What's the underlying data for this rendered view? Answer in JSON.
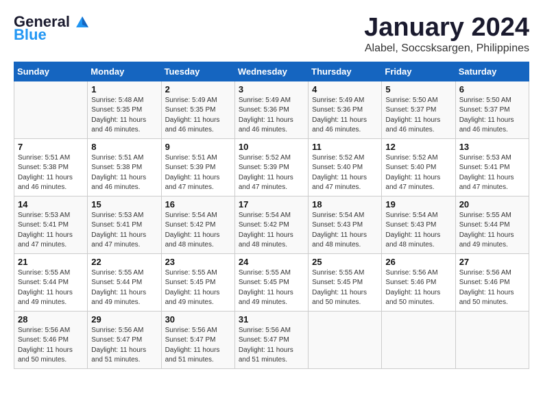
{
  "header": {
    "logo_line1": "General",
    "logo_line2": "Blue",
    "month": "January 2024",
    "location": "Alabel, Soccsksargen, Philippines"
  },
  "days_of_week": [
    "Sunday",
    "Monday",
    "Tuesday",
    "Wednesday",
    "Thursday",
    "Friday",
    "Saturday"
  ],
  "weeks": [
    [
      {
        "day": "",
        "info": ""
      },
      {
        "day": "1",
        "info": "Sunrise: 5:48 AM\nSunset: 5:35 PM\nDaylight: 11 hours\nand 46 minutes."
      },
      {
        "day": "2",
        "info": "Sunrise: 5:49 AM\nSunset: 5:35 PM\nDaylight: 11 hours\nand 46 minutes."
      },
      {
        "day": "3",
        "info": "Sunrise: 5:49 AM\nSunset: 5:36 PM\nDaylight: 11 hours\nand 46 minutes."
      },
      {
        "day": "4",
        "info": "Sunrise: 5:49 AM\nSunset: 5:36 PM\nDaylight: 11 hours\nand 46 minutes."
      },
      {
        "day": "5",
        "info": "Sunrise: 5:50 AM\nSunset: 5:37 PM\nDaylight: 11 hours\nand 46 minutes."
      },
      {
        "day": "6",
        "info": "Sunrise: 5:50 AM\nSunset: 5:37 PM\nDaylight: 11 hours\nand 46 minutes."
      }
    ],
    [
      {
        "day": "7",
        "info": "Sunrise: 5:51 AM\nSunset: 5:38 PM\nDaylight: 11 hours\nand 46 minutes."
      },
      {
        "day": "8",
        "info": "Sunrise: 5:51 AM\nSunset: 5:38 PM\nDaylight: 11 hours\nand 46 minutes."
      },
      {
        "day": "9",
        "info": "Sunrise: 5:51 AM\nSunset: 5:39 PM\nDaylight: 11 hours\nand 47 minutes."
      },
      {
        "day": "10",
        "info": "Sunrise: 5:52 AM\nSunset: 5:39 PM\nDaylight: 11 hours\nand 47 minutes."
      },
      {
        "day": "11",
        "info": "Sunrise: 5:52 AM\nSunset: 5:40 PM\nDaylight: 11 hours\nand 47 minutes."
      },
      {
        "day": "12",
        "info": "Sunrise: 5:52 AM\nSunset: 5:40 PM\nDaylight: 11 hours\nand 47 minutes."
      },
      {
        "day": "13",
        "info": "Sunrise: 5:53 AM\nSunset: 5:41 PM\nDaylight: 11 hours\nand 47 minutes."
      }
    ],
    [
      {
        "day": "14",
        "info": "Sunrise: 5:53 AM\nSunset: 5:41 PM\nDaylight: 11 hours\nand 47 minutes."
      },
      {
        "day": "15",
        "info": "Sunrise: 5:53 AM\nSunset: 5:41 PM\nDaylight: 11 hours\nand 47 minutes."
      },
      {
        "day": "16",
        "info": "Sunrise: 5:54 AM\nSunset: 5:42 PM\nDaylight: 11 hours\nand 48 minutes."
      },
      {
        "day": "17",
        "info": "Sunrise: 5:54 AM\nSunset: 5:42 PM\nDaylight: 11 hours\nand 48 minutes."
      },
      {
        "day": "18",
        "info": "Sunrise: 5:54 AM\nSunset: 5:43 PM\nDaylight: 11 hours\nand 48 minutes."
      },
      {
        "day": "19",
        "info": "Sunrise: 5:54 AM\nSunset: 5:43 PM\nDaylight: 11 hours\nand 48 minutes."
      },
      {
        "day": "20",
        "info": "Sunrise: 5:55 AM\nSunset: 5:44 PM\nDaylight: 11 hours\nand 49 minutes."
      }
    ],
    [
      {
        "day": "21",
        "info": "Sunrise: 5:55 AM\nSunset: 5:44 PM\nDaylight: 11 hours\nand 49 minutes."
      },
      {
        "day": "22",
        "info": "Sunrise: 5:55 AM\nSunset: 5:44 PM\nDaylight: 11 hours\nand 49 minutes."
      },
      {
        "day": "23",
        "info": "Sunrise: 5:55 AM\nSunset: 5:45 PM\nDaylight: 11 hours\nand 49 minutes."
      },
      {
        "day": "24",
        "info": "Sunrise: 5:55 AM\nSunset: 5:45 PM\nDaylight: 11 hours\nand 49 minutes."
      },
      {
        "day": "25",
        "info": "Sunrise: 5:55 AM\nSunset: 5:45 PM\nDaylight: 11 hours\nand 50 minutes."
      },
      {
        "day": "26",
        "info": "Sunrise: 5:56 AM\nSunset: 5:46 PM\nDaylight: 11 hours\nand 50 minutes."
      },
      {
        "day": "27",
        "info": "Sunrise: 5:56 AM\nSunset: 5:46 PM\nDaylight: 11 hours\nand 50 minutes."
      }
    ],
    [
      {
        "day": "28",
        "info": "Sunrise: 5:56 AM\nSunset: 5:46 PM\nDaylight: 11 hours\nand 50 minutes."
      },
      {
        "day": "29",
        "info": "Sunrise: 5:56 AM\nSunset: 5:47 PM\nDaylight: 11 hours\nand 51 minutes."
      },
      {
        "day": "30",
        "info": "Sunrise: 5:56 AM\nSunset: 5:47 PM\nDaylight: 11 hours\nand 51 minutes."
      },
      {
        "day": "31",
        "info": "Sunrise: 5:56 AM\nSunset: 5:47 PM\nDaylight: 11 hours\nand 51 minutes."
      },
      {
        "day": "",
        "info": ""
      },
      {
        "day": "",
        "info": ""
      },
      {
        "day": "",
        "info": ""
      }
    ]
  ]
}
